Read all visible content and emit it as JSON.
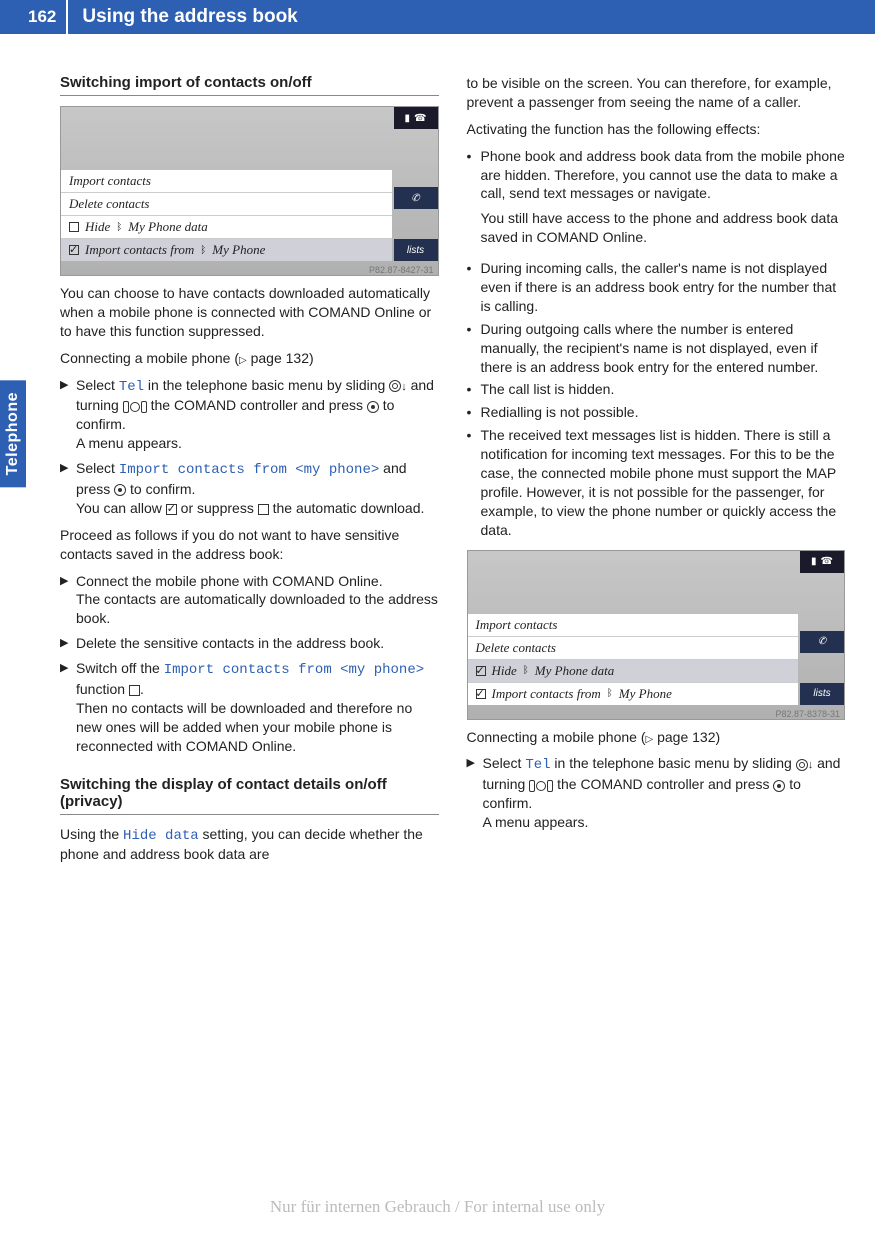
{
  "page_number": "162",
  "header_title": "Using the address book",
  "side_tab": "Telephone",
  "watermark": "Nur für internen Gebrauch / For internal use only",
  "screenshot1": {
    "caption": "P82.87-8427-31",
    "menu": [
      "Import contacts",
      "Delete contacts",
      "Hide",
      "My Phone data",
      "Import contacts from",
      "My Phone"
    ],
    "lists": "lists"
  },
  "screenshot2": {
    "caption": "P82.87-8378-31",
    "menu": [
      "Import contacts",
      "Delete contacts",
      "Hide",
      "My Phone data",
      "Import contacts from",
      "My Phone"
    ],
    "lists": "lists"
  },
  "left": {
    "h1": "Switching import of contacts on/off",
    "p1": "You can choose to have contacts downloaded automatically when a mobile phone is connected with COMAND Online or to have this function suppressed.",
    "p2a": "Connecting a mobile phone (",
    "p2b": " page 132)",
    "s1a": "Select ",
    "s1_tel": "Tel",
    "s1b": " in the telephone basic menu by sliding ",
    "s1c": " and turning ",
    "s1d": " the COMAND controller and press ",
    "s1e": " to confirm.",
    "s1f": "A menu appears.",
    "s2a": "Select ",
    "s2_link": "Import contacts from <my phone>",
    "s2b": " and press ",
    "s2c": " to confirm.",
    "s2d": "You can allow ",
    "s2e": " or suppress ",
    "s2f": " the automatic download.",
    "p3": "Proceed as follows if you do not want to have sensitive contacts saved in the address book:",
    "s3a": "Connect the mobile phone with COMAND Online.",
    "s3b": "The contacts are automatically downloaded to the address book.",
    "s4": "Delete the sensitive contacts in the address book.",
    "s5a": "Switch off the ",
    "s5_link": "Import contacts from <my phone>",
    "s5b": " function ",
    "s5c": ".",
    "s5d": "Then no contacts will be downloaded and therefore no new ones will be added when your mobile phone is reconnected with COMAND Online.",
    "h2": "Switching the display of contact details on/off (privacy)",
    "p4a": "Using the ",
    "p4_link": "Hide data",
    "p4b": " setting, you can decide whether the phone and address book data are"
  },
  "right": {
    "p1": "to be visible on the screen. You can therefore, for example, prevent a passenger from seeing the name of a caller.",
    "p2": "Activating the function has the following effects:",
    "b1a": "Phone book and address book data from the mobile phone are hidden. Therefore, you cannot use the data to make a call, send text messages or navigate.",
    "b1b": "You still have access to the phone and address book data saved in COMAND Online.",
    "b2": "During incoming calls, the caller's name is not displayed even if there is an address book entry for the number that is calling.",
    "b3": "During outgoing calls where the number is entered manually, the recipient's name is not displayed, even if there is an address book entry for the entered number.",
    "b4": "The call list is hidden.",
    "b5": "Redialling is not possible.",
    "b6": "The received text messages list is hidden. There is still a notification for incoming text messages. For this to be the case, the connected mobile phone must support the MAP profile. However, it is not possible for the passenger, for example, to view the phone number or quickly access the data.",
    "p3a": "Connecting a mobile phone (",
    "p3b": " page 132)",
    "s1a": "Select ",
    "s1_tel": "Tel",
    "s1b": " in the telephone basic menu by sliding ",
    "s1c": " and turning ",
    "s1d": " the COMAND controller and press ",
    "s1e": " to confirm.",
    "s1f": "A menu appears."
  }
}
